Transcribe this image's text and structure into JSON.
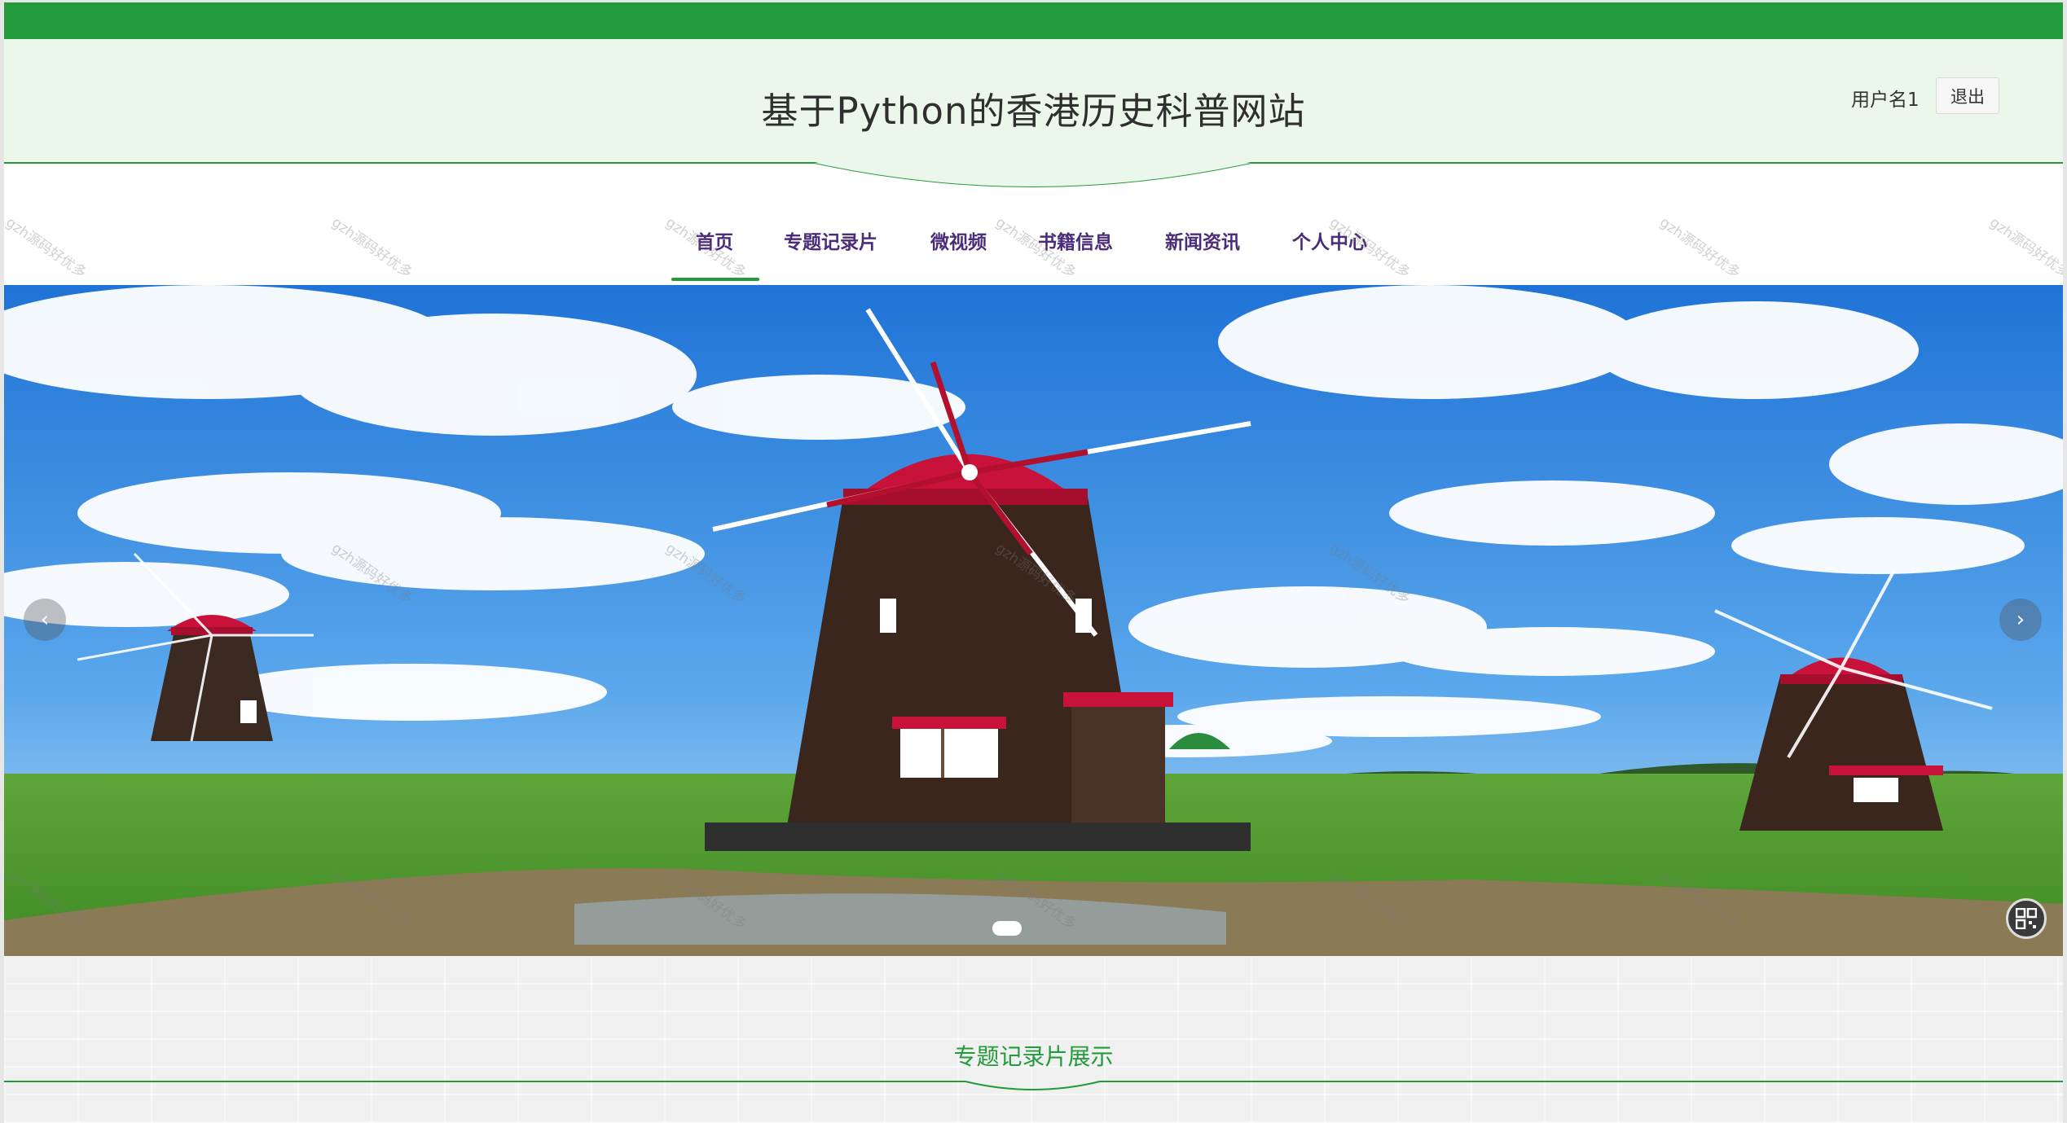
{
  "header": {
    "site_title": "基于Python的香港历史科普网站",
    "user_name": "用户名1",
    "logout_label": "退出"
  },
  "nav": {
    "items": [
      {
        "label": "首页",
        "active": true
      },
      {
        "label": "专题记录片",
        "active": false
      },
      {
        "label": "微视频",
        "active": false
      },
      {
        "label": "书籍信息",
        "active": false
      },
      {
        "label": "新闻资讯",
        "active": false
      },
      {
        "label": "个人中心",
        "active": false
      }
    ]
  },
  "banner": {
    "prev_icon": "chevron-left-icon",
    "next_icon": "chevron-right-icon",
    "slide_count": 1,
    "current_slide": 1,
    "corner_icon": "qr-code-icon"
  },
  "section": {
    "title": "专题记录片展示"
  },
  "watermark": "gzh源码好优多",
  "colors": {
    "brand_green": "#239a3b",
    "header_bg": "#eaf7ea",
    "nav_text": "#4b2c7a",
    "section_bg": "#f0f0f0"
  }
}
